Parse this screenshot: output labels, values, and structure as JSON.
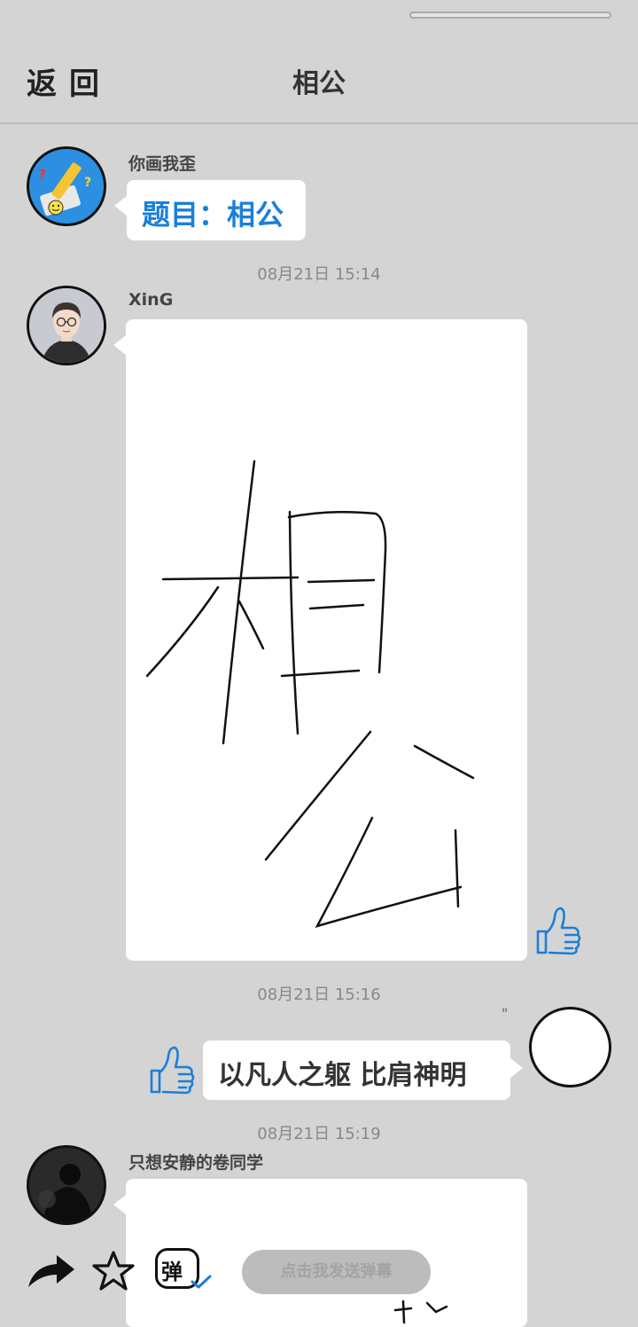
{
  "header": {
    "back_label": "返回",
    "title": "相公"
  },
  "messages": [
    {
      "sender": "你画我歪",
      "type": "text",
      "text": "题目：相公",
      "avatar_icon": "pencil-drawing-app-icon"
    },
    {
      "timestamp": "08月21日  15:14",
      "sender": "XinG",
      "type": "drawing",
      "drawing_depicts": "相公",
      "avatar_icon": "cartoon-man-glasses-avatar",
      "like_icon": "thumbs-up-icon"
    },
    {
      "timestamp": "08月21日  15:16",
      "type": "text",
      "side": "right",
      "text": "以凡人之躯 比肩神明",
      "self_name": "\"",
      "like_icon": "thumbs-up-icon"
    },
    {
      "timestamp": "08月21日  15:19",
      "sender": "只想安静的卷同学",
      "type": "drawing",
      "avatar_icon": "dark-photo-avatar"
    }
  ],
  "bottom_bar": {
    "share_icon": "share-arrow-icon",
    "favorite_icon": "star-icon",
    "danmaku_icon": "danmaku-toggle-icon",
    "danmaku_icon_text": "弹",
    "danmaku_placeholder": "点击我发送弹幕"
  },
  "colors": {
    "background": "#d4d4d4",
    "accent_blue": "#1a7fd9",
    "bubble": "#ffffff"
  }
}
